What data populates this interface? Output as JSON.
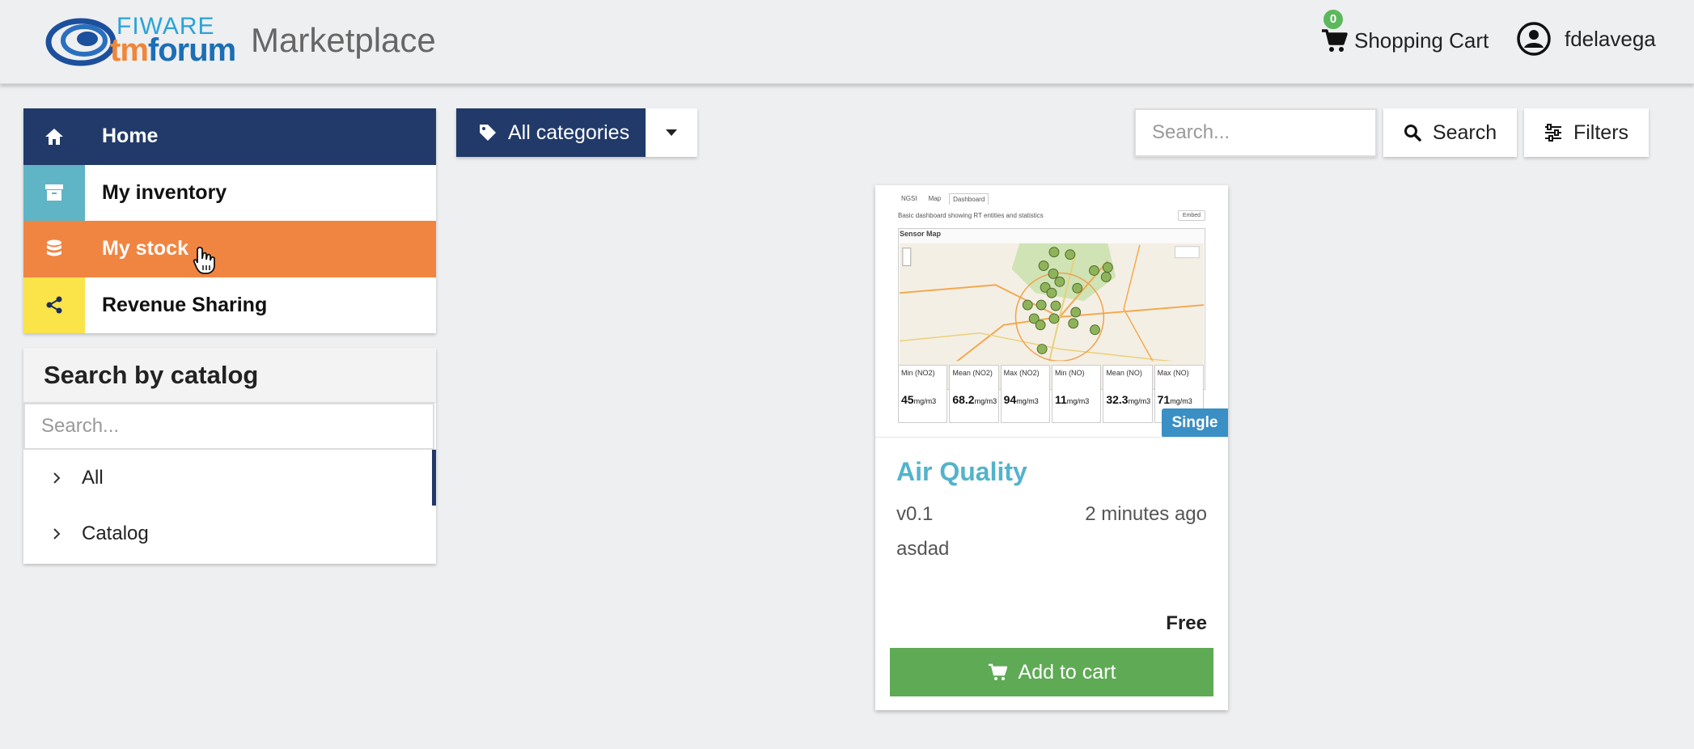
{
  "header": {
    "logo_top": "FIWARE",
    "logo_tm": "tm",
    "logo_forum": "forum",
    "title": "Marketplace",
    "cart_label": "Shopping Cart",
    "cart_count": "0",
    "cart_icon": "shopping-cart-icon",
    "user_label": "fdelavega",
    "user_icon": "user-circle-icon"
  },
  "nav": {
    "items": [
      {
        "label": "Home",
        "icon": "home-icon",
        "color": "#223a6a"
      },
      {
        "label": "My inventory",
        "icon": "archive-icon",
        "color": "#5fb4c6"
      },
      {
        "label": "My stock",
        "icon": "database-icon",
        "color": "#f08542"
      },
      {
        "label": "Revenue Sharing",
        "icon": "share-icon",
        "color": "#fbe34a"
      }
    ]
  },
  "catalog": {
    "title": "Search by catalog",
    "search_placeholder": "Search...",
    "items": [
      {
        "label": "All"
      },
      {
        "label": "Catalog"
      }
    ]
  },
  "toolbar": {
    "categories_label": "All categories",
    "search_placeholder": "Search...",
    "search_label": "Search",
    "filters_label": "Filters"
  },
  "product": {
    "badge": "Single",
    "name": "Air Quality",
    "version": "v0.1",
    "time": "2 minutes ago",
    "description": "asdad",
    "price": "Free",
    "add_label": "Add to cart",
    "thumbnail": {
      "tabs": [
        "NGSI",
        "Map",
        "Dashboard"
      ],
      "description": "Basic dashboard showing RT entities and statistics",
      "embed": "Embed",
      "map_title": "Sensor Map",
      "stats": [
        {
          "label": "Min (NO2)",
          "value": "45",
          "unit": "mg/m3"
        },
        {
          "label": "Mean (NO2)",
          "value": "68.2",
          "unit": "mg/m3"
        },
        {
          "label": "Max (NO2)",
          "value": "94",
          "unit": "mg/m3"
        },
        {
          "label": "Min (NO)",
          "value": "11",
          "unit": "mg/m3"
        },
        {
          "label": "Mean (NO)",
          "value": "32.3",
          "unit": "mg/m3"
        },
        {
          "label": "Max (NO)",
          "value": "71",
          "unit": "mg/m3"
        }
      ]
    }
  },
  "colors": {
    "primary": "#223a6a",
    "accent_green": "#5faa55",
    "link": "#53b3cb",
    "badge_blue": "#3a8fc4"
  }
}
